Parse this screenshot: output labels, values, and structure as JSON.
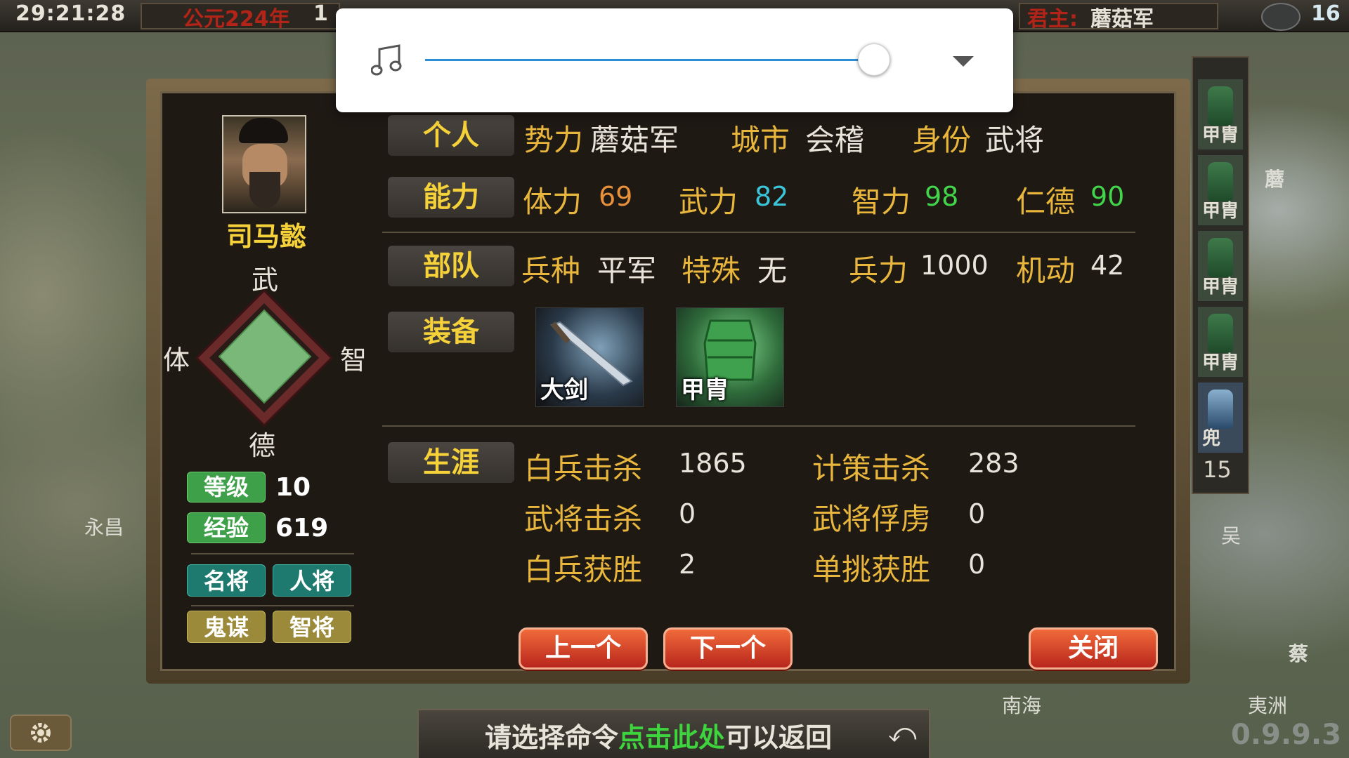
{
  "topbar": {
    "time": "29:21:28",
    "era_label": "公元224年",
    "era_suffix": "1",
    "lord_label": "君主:",
    "lord_name": "蘑菇军",
    "count": "16"
  },
  "music_overlay": {
    "icon": "music-note-icon",
    "volume": 0.84,
    "expand_icon": "dropdown-arrow-icon",
    "accent_color": "#2d8fd6"
  },
  "general": {
    "name": "司马懿",
    "radar_labels": {
      "top": "武",
      "left": "体",
      "right": "智",
      "bottom": "德"
    },
    "level_label": "等级",
    "level": "10",
    "exp_label": "经验",
    "exp": "619",
    "traits": [
      "名将",
      "人将",
      "鬼谋",
      "智将"
    ]
  },
  "personal": {
    "tag": "个人",
    "faction_label": "势力",
    "faction": "蘑菇军",
    "city_label": "城市",
    "city": "会稽",
    "identity_label": "身份",
    "identity": "武将"
  },
  "ability": {
    "tag": "能力",
    "stamina_label": "体力",
    "stamina": "69",
    "force_label": "武力",
    "force": "82",
    "intellect_label": "智力",
    "intellect": "98",
    "virtue_label": "仁德",
    "virtue": "90"
  },
  "troops": {
    "tag": "部队",
    "type_label": "兵种",
    "type": "平军",
    "special_label": "特殊",
    "special": "无",
    "strength_label": "兵力",
    "strength": "1000",
    "mobility_label": "机动",
    "mobility": "42"
  },
  "equipment": {
    "tag": "装备",
    "items": [
      "大剑",
      "甲胄"
    ]
  },
  "career": {
    "tag": "生涯",
    "infantry_kills_label": "白兵击杀",
    "infantry_kills": "1865",
    "strategy_kills_label": "计策击杀",
    "strategy_kills": "283",
    "general_kills_label": "武将击杀",
    "general_kills": "0",
    "general_captures_label": "武将俘虏",
    "general_captures": "0",
    "infantry_wins_label": "白兵获胜",
    "infantry_wins": "2",
    "duel_wins_label": "单挑获胜",
    "duel_wins": "0"
  },
  "buttons": {
    "prev": "上一个",
    "next": "下一个",
    "close": "关闭"
  },
  "sidebar": {
    "slots": [
      "甲胄",
      "甲胄",
      "甲胄",
      "甲胄",
      "兜"
    ],
    "number": "15"
  },
  "map_labels": {
    "yongchang": "永昌",
    "nanhai": "南海",
    "wu": "吴",
    "yizhou": "夷洲",
    "cai": "蔡",
    "mogu": "蘑"
  },
  "bottom": {
    "prompt_a": "请选择命令",
    "prompt_link": "点击此处",
    "prompt_b": "可以返回",
    "version": "0.9.9.3"
  }
}
